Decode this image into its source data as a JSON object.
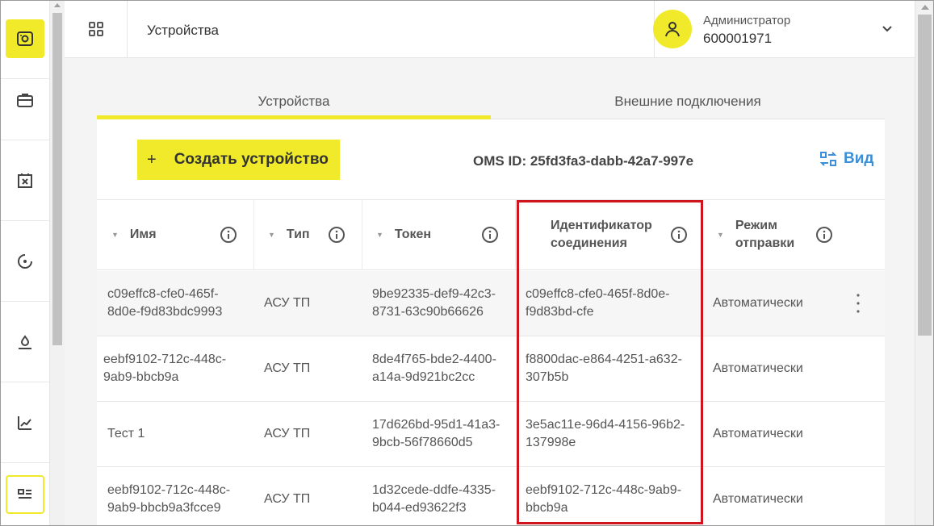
{
  "header": {
    "title": "Устройства",
    "user_role": "Администратор",
    "user_id": "600001971"
  },
  "tabs": [
    {
      "label": "Устройства",
      "active": true
    },
    {
      "label": "Внешние подключения",
      "active": false
    }
  ],
  "toolbar": {
    "create_plus": "+",
    "create_label": "Создать устройство",
    "oms_id": "OMS ID: 25fd3fa3-dabb-42a7-997e",
    "view_label": "Вид"
  },
  "table": {
    "columns": [
      {
        "label": "Имя",
        "sortable": true
      },
      {
        "label": "Тип",
        "sortable": true
      },
      {
        "label": "Токен",
        "sortable": true
      },
      {
        "label": "Идентификатор соединения",
        "sortable": false
      },
      {
        "label": "Режим отправки",
        "sortable": true
      }
    ],
    "rows": [
      {
        "name": "c09effc8-cfe0-465f-8d0e-f9d83bdc9993",
        "type": "АСУ ТП",
        "token": "9be92335-def9-42c3-8731-63c90b66626",
        "conn_id": "c09effc8-cfe0-465f-8d0e-f9d83bd-cfe",
        "mode": "Автоматически"
      },
      {
        "name": "eebf9102-712c-448c-9ab9-bbcb9a",
        "type": "АСУ ТП",
        "token": "8de4f765-bde2-4400-a14a-9d921bc2cc",
        "conn_id": "f8800dac-e864-4251-a632-307b5b",
        "mode": "Автоматически"
      },
      {
        "name": "Тест 1",
        "type": "АСУ ТП",
        "token": "17d626bd-95d1-41a3-9bcb-56f78660d5",
        "conn_id": "3e5ac11e-96d4-4156-96b2-137998e",
        "mode": "Автоматически"
      },
      {
        "name": "eebf9102-712c-448c-9ab9-bbcb9a3fcce9",
        "type": "АСУ ТП",
        "token": "1d32cede-ddfe-4335-b044-ed93622f3",
        "conn_id": "eebf9102-712c-448c-9ab9-bbcb9a",
        "mode": "Автоматически"
      }
    ]
  },
  "colors": {
    "accent": "#f0ea2a",
    "link": "#3a8fd8",
    "highlight": "#d0141e"
  },
  "icons": {
    "sidebar": [
      "device-settings-icon",
      "briefcase-icon",
      "calendar-cancel-icon",
      "target-icon",
      "water-drop-icon",
      "trending-up-icon",
      "list-view-icon"
    ]
  }
}
